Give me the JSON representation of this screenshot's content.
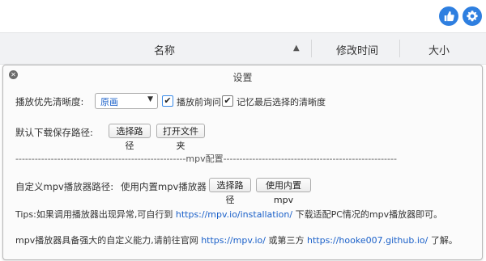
{
  "toolbar": {
    "like_icon": "thumbs-up-icon",
    "settings_icon": "gear-icon"
  },
  "table": {
    "col_name": "名称",
    "col_sort": "▲",
    "col_modified": "修改时间",
    "col_size": "大小"
  },
  "dialog": {
    "title": "设置",
    "quality_label": "播放优先清晰度:",
    "quality_value": "原画",
    "ask_before_play": "播放前询问",
    "remember_quality": "记忆最后选择的清晰度",
    "download_label": "默认下载保存路径:",
    "choose_path": "选择路径",
    "open_folder": "打开文件夹",
    "divider": "-----------------------------------------------------mpv配置------------------------------------------------------",
    "mpv_path_label": "自定义mpv播放器路径:",
    "mpv_path_value": "使用内置mpv播放器",
    "mpv_choose_path": "选择路径",
    "mpv_use_builtin": "使用内置mpv",
    "tips_prefix": "Tips:如果调用播放器出现异常,可自行到",
    "tips_link": "https://mpv.io/installation/",
    "tips_suffix": "下载适配PC情况的mpv播放器即可。",
    "info_prefix": "mpv播放器具备强大的自定义能力,请前往官网",
    "info_link1": "https://mpv.io/",
    "info_mid": "或第三方",
    "info_link2": "https://hooke007.github.io/",
    "info_suffix": "了解。"
  },
  "colors": {
    "accent": "#2e7fe0",
    "link": "#1a60c9"
  }
}
